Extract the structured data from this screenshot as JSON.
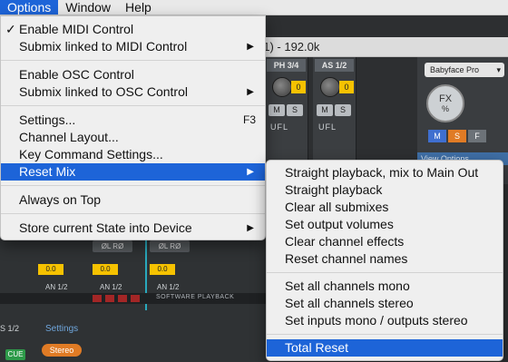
{
  "menubar": {
    "items": [
      "Options",
      "Window",
      "Help"
    ],
    "active_index": 0
  },
  "app": {
    "window_title": "01) - 192.0k",
    "channels": [
      {
        "label": "PH 3/4",
        "gain": "0",
        "mute": "M",
        "solo": "S",
        "io": "UFL"
      },
      {
        "label": "AS 1/2",
        "gain": "0",
        "mute": "M",
        "solo": "S",
        "io": "UFL"
      }
    ],
    "right_panel": {
      "device_button": "Babyface Pro",
      "fx_label": "FX",
      "fx_unit": "%",
      "buttons": [
        "M",
        "S",
        "F"
      ],
      "view_options": "View Options"
    },
    "lower": {
      "lr_buttons": [
        "ØL RØ",
        "ØL RØ"
      ],
      "values": [
        "0.0",
        "0.0",
        "0.0"
      ],
      "labels": [
        "AN 1/2",
        "AN 1/2",
        "AN 1/2"
      ],
      "software_playback": "SOFTWARE PLAYBACK",
      "settings_label": "Settings",
      "stereo_button": "Stereo",
      "s12_label": "S 1/2",
      "cue_button": "CUE"
    }
  },
  "options_menu": {
    "items": [
      {
        "label": "Enable MIDI Control",
        "checked": true
      },
      {
        "label": "Submix linked to MIDI Control",
        "submenu": true
      },
      {
        "label": "Enable OSC Control"
      },
      {
        "label": "Submix linked to OSC Control",
        "submenu": true
      },
      {
        "label": "Settings...",
        "shortcut": "F3"
      },
      {
        "label": "Channel Layout..."
      },
      {
        "label": "Key Command Settings..."
      },
      {
        "label": "Reset Mix",
        "submenu": true,
        "highlighted": true
      },
      {
        "label": "Always on Top"
      },
      {
        "label": "Store current State into Device",
        "submenu": true
      }
    ]
  },
  "reset_mix_submenu": {
    "items": [
      "Straight playback, mix to Main Out",
      "Straight playback",
      "Clear all submixes",
      "Set output volumes",
      "Clear channel effects",
      "Reset channel names",
      "Set all channels mono",
      "Set all channels stereo",
      "Set inputs mono / outputs stereo",
      "Total Reset"
    ],
    "highlighted_index": 9
  },
  "colors": {
    "highlight": "#1d64d8",
    "menu_bg": "#efefef",
    "app_bg": "#2d2f31",
    "yellow": "#f6c200",
    "orange": "#e07b25"
  }
}
